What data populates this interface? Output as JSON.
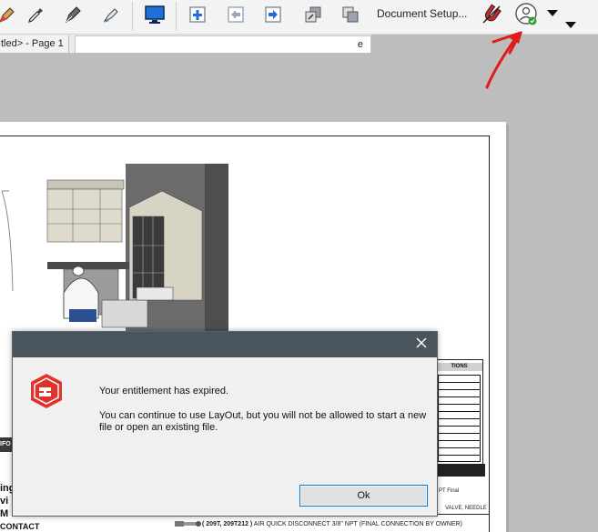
{
  "toolbar": {
    "items": [
      {
        "name": "pencil-icon"
      },
      {
        "name": "eyedropper-icon"
      },
      {
        "name": "pen-nib-icon"
      },
      {
        "name": "style-brush-icon"
      },
      {
        "name": "monitor-icon"
      },
      {
        "name": "add-page-icon"
      },
      {
        "name": "previous-page-icon"
      },
      {
        "name": "next-page-icon"
      },
      {
        "name": "send-back-icon"
      },
      {
        "name": "bring-forward-icon"
      },
      {
        "name": "magnet-icon"
      },
      {
        "name": "account-icon"
      }
    ],
    "document_setup_label": "Document Setup...",
    "accent": "#1e6fd9",
    "account_status_color": "#2e9d3a"
  },
  "tabs": [
    {
      "label": "tled> - Page 1"
    },
    {
      "label": "e"
    }
  ],
  "drawing": {
    "schedule_title": "TIONS",
    "note_1": "PT Final",
    "note_2": "VALVE, NEEDLE",
    "bottom_line_bold": "( 209T, 209T212 )",
    "bottom_line_rest": " AIR QUICK DISCONNECT 3/8\" NPT (FINAL CONNECTION BY OWNER)",
    "title_block_label": "IFO",
    "side_letters": [
      "ing",
      "vi",
      "M"
    ],
    "contact_label": "CONTACT"
  },
  "dialog": {
    "message_primary": "Your entitlement has expired.",
    "message_secondary": "You can continue to use LayOut, but you will not be allowed to start a new file or open an existing file.",
    "ok_label": "Ok",
    "titlebar_color": "#4a545c",
    "brand_color": "#e0332b"
  },
  "annotation": {
    "color": "#e01b1b"
  }
}
